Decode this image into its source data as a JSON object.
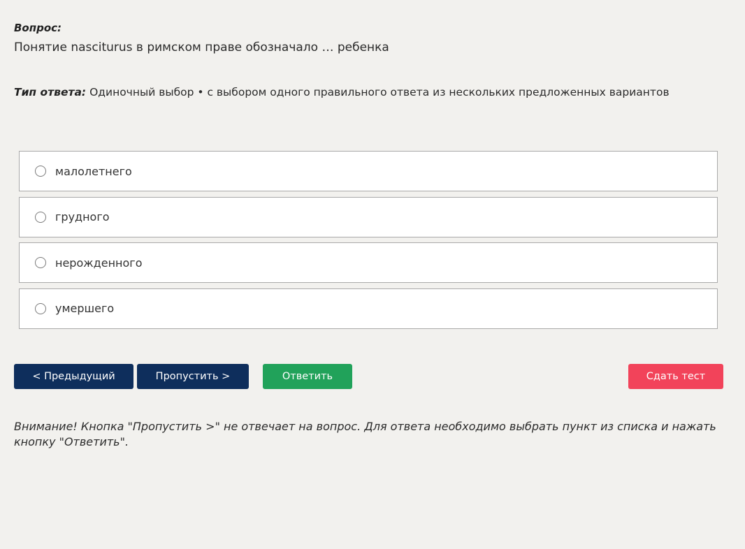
{
  "question": {
    "label": "Вопрос:",
    "text": "Понятие nasciturus в римском праве обозначало … ребенка"
  },
  "answer_type": {
    "label": "Тип ответа:",
    "value": "Одиночный выбор • с выбором одного правильного ответа из нескольких предложенных вариантов"
  },
  "options": [
    {
      "label": "малолетнего"
    },
    {
      "label": "грудного"
    },
    {
      "label": "нерожденного"
    },
    {
      "label": "умершего"
    }
  ],
  "buttons": {
    "prev": "< Предыдущий",
    "skip": "Пропустить >",
    "answer": "Ответить",
    "submit": "Сдать тест"
  },
  "notice": "Внимание! Кнопка \"Пропустить >\" не отвечает на вопрос. Для ответа необходимо выбрать пункт из списка и нажать кнопку \"Ответить\".",
  "colors": {
    "nav_button": "#0e2e5c",
    "answer_button": "#21a25a",
    "submit_button": "#f2435a",
    "background": "#f2f1ee"
  }
}
